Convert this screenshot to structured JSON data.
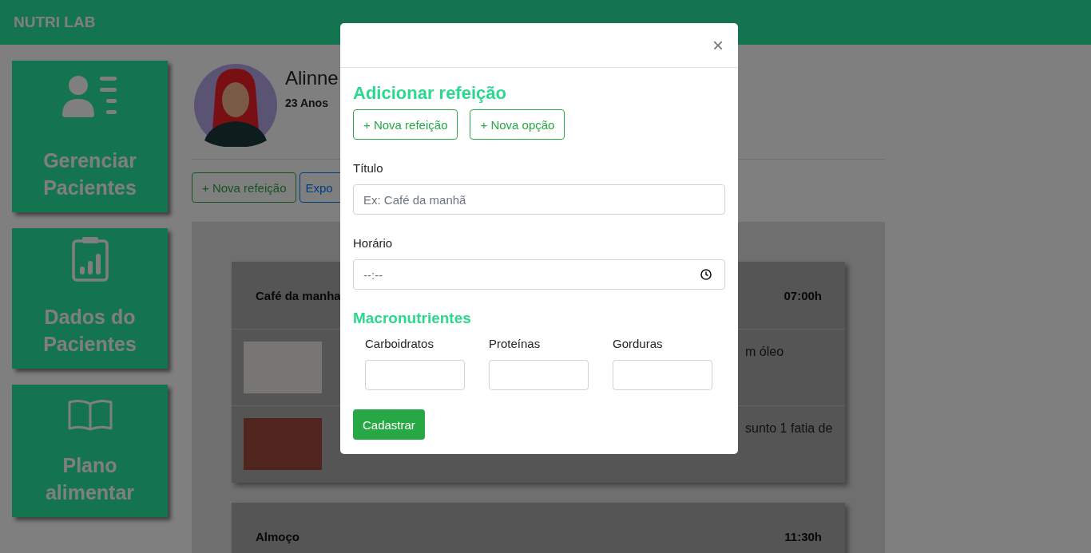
{
  "app": {
    "brand": "NUTRI LAB"
  },
  "sidebar": {
    "items": [
      {
        "label": "Gerenciar Pacientes",
        "kind": "patients"
      },
      {
        "label": "Dados do Pacientes",
        "kind": "report"
      },
      {
        "label": "Plano alimentar",
        "kind": "book"
      }
    ]
  },
  "patient": {
    "name": "Alinne",
    "age": "23 Anos"
  },
  "actions": [
    {
      "label": "+ Nova refeição",
      "kind": "success"
    },
    {
      "label": "Expo",
      "kind": "primary"
    }
  ],
  "meals": [
    {
      "title": "Café da manha",
      "time": "07:00h",
      "items": [
        {
          "text": "m óleo"
        },
        {
          "text": "sunto 1 fatia de"
        }
      ]
    },
    {
      "title": "Almoço",
      "time": "11:30h"
    }
  ],
  "modal": {
    "close": "×",
    "heading": "Adicionar refeição",
    "buttons": [
      "+ Nova refeição",
      "+ Nova opção"
    ],
    "fields": [
      {
        "label": "Título",
        "placeholder": "Ex: Café da manhã",
        "kind": "text"
      },
      {
        "label": "Horário",
        "placeholder": "--:--",
        "kind": "time"
      }
    ],
    "macros_heading": "Macronutrientes",
    "macros": [
      {
        "label": "Carboidratos"
      },
      {
        "label": "Proteínas"
      },
      {
        "label": "Gorduras"
      }
    ],
    "submit": "Cadastrar"
  }
}
